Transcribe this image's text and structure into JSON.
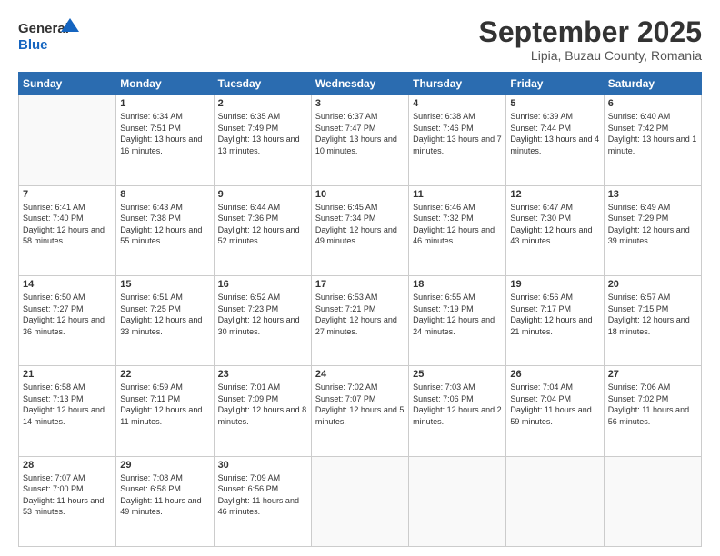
{
  "logo": {
    "line1": "General",
    "line2": "Blue"
  },
  "header": {
    "month": "September 2025",
    "location": "Lipia, Buzau County, Romania"
  },
  "weekdays": [
    "Sunday",
    "Monday",
    "Tuesday",
    "Wednesday",
    "Thursday",
    "Friday",
    "Saturday"
  ],
  "weeks": [
    [
      {
        "day": "",
        "empty": true
      },
      {
        "day": "1",
        "sunrise": "6:34 AM",
        "sunset": "7:51 PM",
        "daylight": "13 hours and 16 minutes."
      },
      {
        "day": "2",
        "sunrise": "6:35 AM",
        "sunset": "7:49 PM",
        "daylight": "13 hours and 13 minutes."
      },
      {
        "day": "3",
        "sunrise": "6:37 AM",
        "sunset": "7:47 PM",
        "daylight": "13 hours and 10 minutes."
      },
      {
        "day": "4",
        "sunrise": "6:38 AM",
        "sunset": "7:46 PM",
        "daylight": "13 hours and 7 minutes."
      },
      {
        "day": "5",
        "sunrise": "6:39 AM",
        "sunset": "7:44 PM",
        "daylight": "13 hours and 4 minutes."
      },
      {
        "day": "6",
        "sunrise": "6:40 AM",
        "sunset": "7:42 PM",
        "daylight": "13 hours and 1 minute."
      }
    ],
    [
      {
        "day": "7",
        "sunrise": "6:41 AM",
        "sunset": "7:40 PM",
        "daylight": "12 hours and 58 minutes."
      },
      {
        "day": "8",
        "sunrise": "6:43 AM",
        "sunset": "7:38 PM",
        "daylight": "12 hours and 55 minutes."
      },
      {
        "day": "9",
        "sunrise": "6:44 AM",
        "sunset": "7:36 PM",
        "daylight": "12 hours and 52 minutes."
      },
      {
        "day": "10",
        "sunrise": "6:45 AM",
        "sunset": "7:34 PM",
        "daylight": "12 hours and 49 minutes."
      },
      {
        "day": "11",
        "sunrise": "6:46 AM",
        "sunset": "7:32 PM",
        "daylight": "12 hours and 46 minutes."
      },
      {
        "day": "12",
        "sunrise": "6:47 AM",
        "sunset": "7:30 PM",
        "daylight": "12 hours and 43 minutes."
      },
      {
        "day": "13",
        "sunrise": "6:49 AM",
        "sunset": "7:29 PM",
        "daylight": "12 hours and 39 minutes."
      }
    ],
    [
      {
        "day": "14",
        "sunrise": "6:50 AM",
        "sunset": "7:27 PM",
        "daylight": "12 hours and 36 minutes."
      },
      {
        "day": "15",
        "sunrise": "6:51 AM",
        "sunset": "7:25 PM",
        "daylight": "12 hours and 33 minutes."
      },
      {
        "day": "16",
        "sunrise": "6:52 AM",
        "sunset": "7:23 PM",
        "daylight": "12 hours and 30 minutes."
      },
      {
        "day": "17",
        "sunrise": "6:53 AM",
        "sunset": "7:21 PM",
        "daylight": "12 hours and 27 minutes."
      },
      {
        "day": "18",
        "sunrise": "6:55 AM",
        "sunset": "7:19 PM",
        "daylight": "12 hours and 24 minutes."
      },
      {
        "day": "19",
        "sunrise": "6:56 AM",
        "sunset": "7:17 PM",
        "daylight": "12 hours and 21 minutes."
      },
      {
        "day": "20",
        "sunrise": "6:57 AM",
        "sunset": "7:15 PM",
        "daylight": "12 hours and 18 minutes."
      }
    ],
    [
      {
        "day": "21",
        "sunrise": "6:58 AM",
        "sunset": "7:13 PM",
        "daylight": "12 hours and 14 minutes."
      },
      {
        "day": "22",
        "sunrise": "6:59 AM",
        "sunset": "7:11 PM",
        "daylight": "12 hours and 11 minutes."
      },
      {
        "day": "23",
        "sunrise": "7:01 AM",
        "sunset": "7:09 PM",
        "daylight": "12 hours and 8 minutes."
      },
      {
        "day": "24",
        "sunrise": "7:02 AM",
        "sunset": "7:07 PM",
        "daylight": "12 hours and 5 minutes."
      },
      {
        "day": "25",
        "sunrise": "7:03 AM",
        "sunset": "7:06 PM",
        "daylight": "12 hours and 2 minutes."
      },
      {
        "day": "26",
        "sunrise": "7:04 AM",
        "sunset": "7:04 PM",
        "daylight": "11 hours and 59 minutes."
      },
      {
        "day": "27",
        "sunrise": "7:06 AM",
        "sunset": "7:02 PM",
        "daylight": "11 hours and 56 minutes."
      }
    ],
    [
      {
        "day": "28",
        "sunrise": "7:07 AM",
        "sunset": "7:00 PM",
        "daylight": "11 hours and 53 minutes."
      },
      {
        "day": "29",
        "sunrise": "7:08 AM",
        "sunset": "6:58 PM",
        "daylight": "11 hours and 49 minutes."
      },
      {
        "day": "30",
        "sunrise": "7:09 AM",
        "sunset": "6:56 PM",
        "daylight": "11 hours and 46 minutes."
      },
      {
        "day": "",
        "empty": true
      },
      {
        "day": "",
        "empty": true
      },
      {
        "day": "",
        "empty": true
      },
      {
        "day": "",
        "empty": true
      }
    ]
  ]
}
